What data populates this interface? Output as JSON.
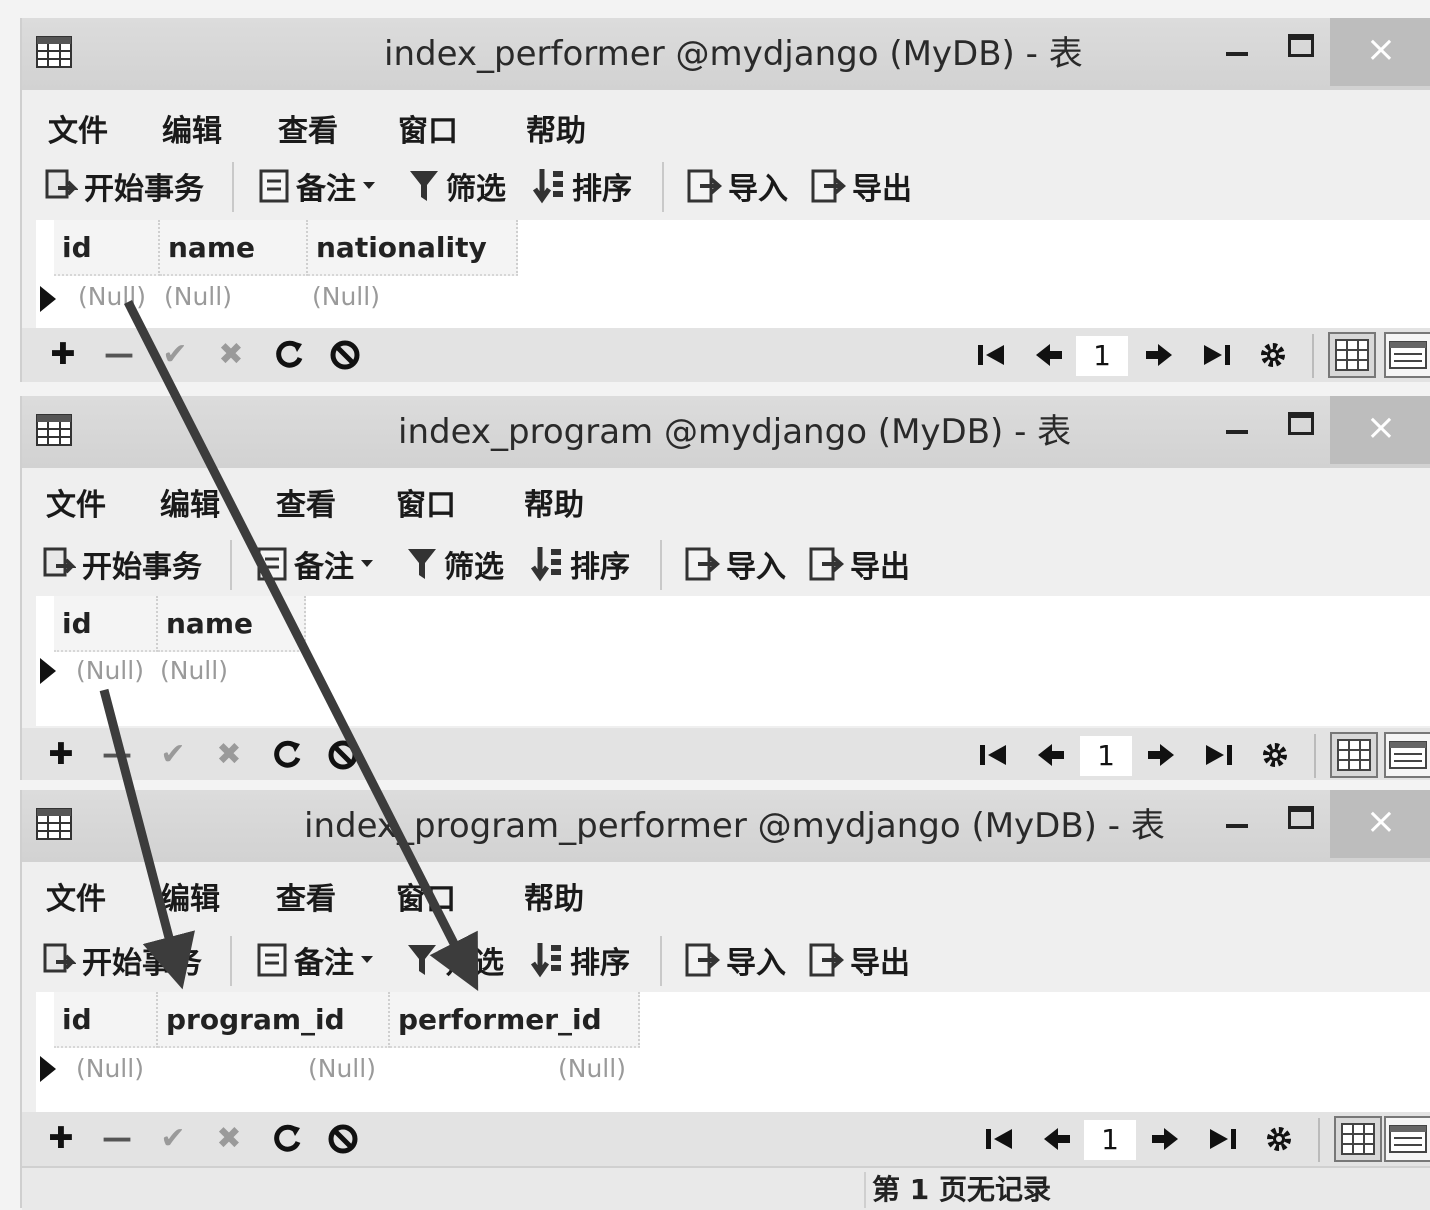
{
  "windows": [
    {
      "title": "index_performer @mydjango (MyDB) - 表",
      "menu": [
        "文件",
        "编辑",
        "查看",
        "窗口",
        "帮助"
      ],
      "toolbar": {
        "begin_transaction": "开始事务",
        "note": "备注",
        "filter": "筛选",
        "sort": "排序",
        "import": "导入",
        "export": "导出"
      },
      "columns": [
        "id",
        "name",
        "nationality"
      ],
      "row": [
        "(Null)",
        "(Null)",
        "(Null)"
      ],
      "page": "1"
    },
    {
      "title": "index_program @mydjango (MyDB) - 表",
      "menu": [
        "文件",
        "编辑",
        "查看",
        "窗口",
        "帮助"
      ],
      "toolbar": {
        "begin_transaction": "开始事务",
        "note": "备注",
        "filter": "筛选",
        "sort": "排序",
        "import": "导入",
        "export": "导出"
      },
      "columns": [
        "id",
        "name"
      ],
      "row": [
        "(Null)",
        "(Null)"
      ],
      "page": "1"
    },
    {
      "title": "index_program_performer @mydjango (MyDB) - 表",
      "menu": [
        "文件",
        "编辑",
        "查看",
        "窗口",
        "帮助"
      ],
      "toolbar": {
        "begin_transaction": "开始事务",
        "note": "备注",
        "filter": "筛选",
        "sort": "排序",
        "import": "导入",
        "export": "导出"
      },
      "columns": [
        "id",
        "program_id",
        "performer_id"
      ],
      "row": [
        "(Null)",
        "(Null)",
        "(Null)"
      ],
      "page": "1",
      "status": "第 1 页无记录"
    }
  ],
  "window_controls": {
    "close_glyph": "×"
  },
  "nav_glyphs": {
    "add": "✚",
    "delete": "—",
    "apply": "✔",
    "discard": "✖"
  },
  "icons": {
    "table": "table-icon",
    "transaction": "transaction-icon",
    "note": "note-icon",
    "filter": "filter-icon",
    "sort": "sort-icon",
    "import": "import-icon",
    "export": "export-icon"
  },
  "colors": {
    "arrow": "#3c3c3c",
    "null_text": "#9a9a9a",
    "title_bar": "#d6d6d6"
  }
}
